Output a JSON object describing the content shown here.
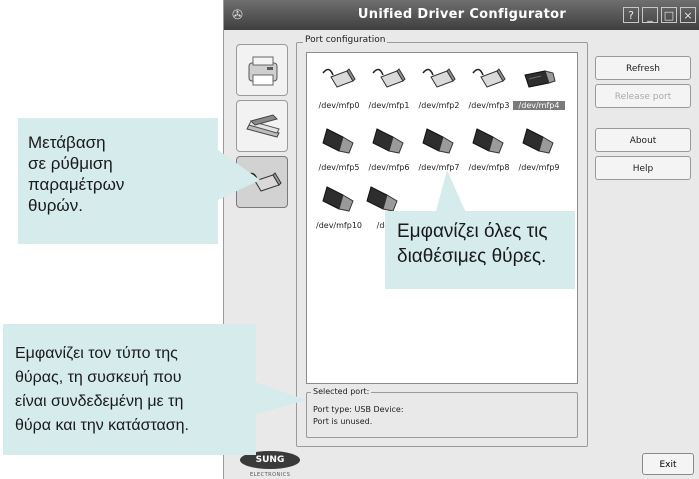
{
  "window": {
    "title": "Unified Driver Configurator",
    "controls": [
      "?",
      "_",
      "□",
      "×"
    ]
  },
  "sidebar": {
    "items": [
      {
        "name": "printers",
        "icon": "printer-icon"
      },
      {
        "name": "scanners",
        "icon": "scanner-icon"
      },
      {
        "name": "ports",
        "icon": "port-icon",
        "active": true
      }
    ]
  },
  "port_config": {
    "group_title": "Port configuration",
    "ports": [
      {
        "label": "/dev/mfp0",
        "kind": "parallel"
      },
      {
        "label": "/dev/mfp1",
        "kind": "parallel"
      },
      {
        "label": "/dev/mfp2",
        "kind": "parallel"
      },
      {
        "label": "/dev/mfp3",
        "kind": "parallel"
      },
      {
        "label": "/dev/mfp4",
        "kind": "usb",
        "selected": true
      },
      {
        "label": "/dev/mfp5",
        "kind": "usb"
      },
      {
        "label": "/dev/mfp6",
        "kind": "usb"
      },
      {
        "label": "/dev/mfp7",
        "kind": "usb"
      },
      {
        "label": "/dev/mfp8",
        "kind": "usb"
      },
      {
        "label": "/dev/mfp9",
        "kind": "usb"
      },
      {
        "label": "/dev/mfp10",
        "kind": "usb"
      },
      {
        "label": "/de",
        "kind": "usb"
      }
    ],
    "selected_port": {
      "title": "Selected port:",
      "line1": "Port type: USB   Device:",
      "line2": "Port is unused."
    }
  },
  "buttons": {
    "refresh": "Refresh",
    "release_port": "Release port",
    "about": "About",
    "help": "Help",
    "exit": "Exit"
  },
  "logo": {
    "text": "SUNG",
    "sub": "ELECTRONICS"
  },
  "callouts": {
    "ports_nav": [
      "Μετάβαση",
      "σε ρύθμιση",
      "παραμέτρων",
      "θυρών."
    ],
    "all_ports": [
      "Εμφανίζει όλες τις",
      "διαθέσιμες θύρες."
    ],
    "port_info": [
      "Εμφανίζει τον τύπο της",
      "θύρας, τη συσκευή που",
      "είναι συνδεδεμένη με τη",
      "θύρα και την κατάσταση."
    ]
  },
  "colors": {
    "callout_bg": "#d6ebec",
    "titlebar": "#4f4f4f",
    "window_bg": "#e9e9e9"
  }
}
